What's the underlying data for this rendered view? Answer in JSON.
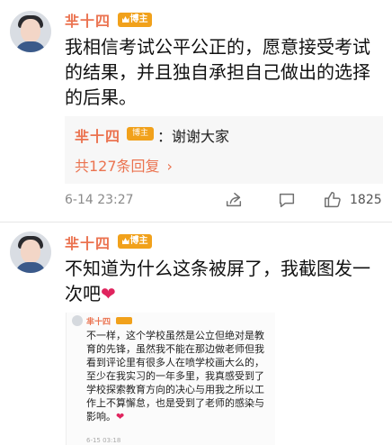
{
  "comments": [
    {
      "username": "芈十四",
      "badge": "博主",
      "text": "我相信考试公平公正的，愿意接受考试的结果，并且独自承担自己做出的选择的后果。",
      "reply": {
        "username": "芈十四",
        "badge": "博主",
        "text": "：谢谢大家",
        "more_label": "共127条回复"
      },
      "timestamp": "6-14 23:27",
      "like_count": "1825"
    },
    {
      "username": "芈十四",
      "badge": "博主",
      "text": "不知道为什么这条被屏了，我截图发一次吧",
      "emoji": "❤",
      "screenshot": {
        "username": "芈十四",
        "text": "不一样，这个学校虽然是公立但绝对是教育的先锋，虽然我不能在那边做老师但我看到评论里有很多人在喷学校画大么的，至少在我实习的一年多里，我真感受到了学校探索教育方向的决心与用我之所以工作上不算懈怠，也是受到了老师的感染与影响。",
        "emoji": "❤",
        "meta": "6-15 03:18"
      }
    }
  ],
  "icons": {
    "share": "share-icon",
    "comment": "comment-icon",
    "like": "thumbs-up-icon",
    "chevron": "chevron-right-icon"
  },
  "colors": {
    "username": "#eb7350",
    "badge": "#f1a11b",
    "heart": "#e0245e"
  }
}
